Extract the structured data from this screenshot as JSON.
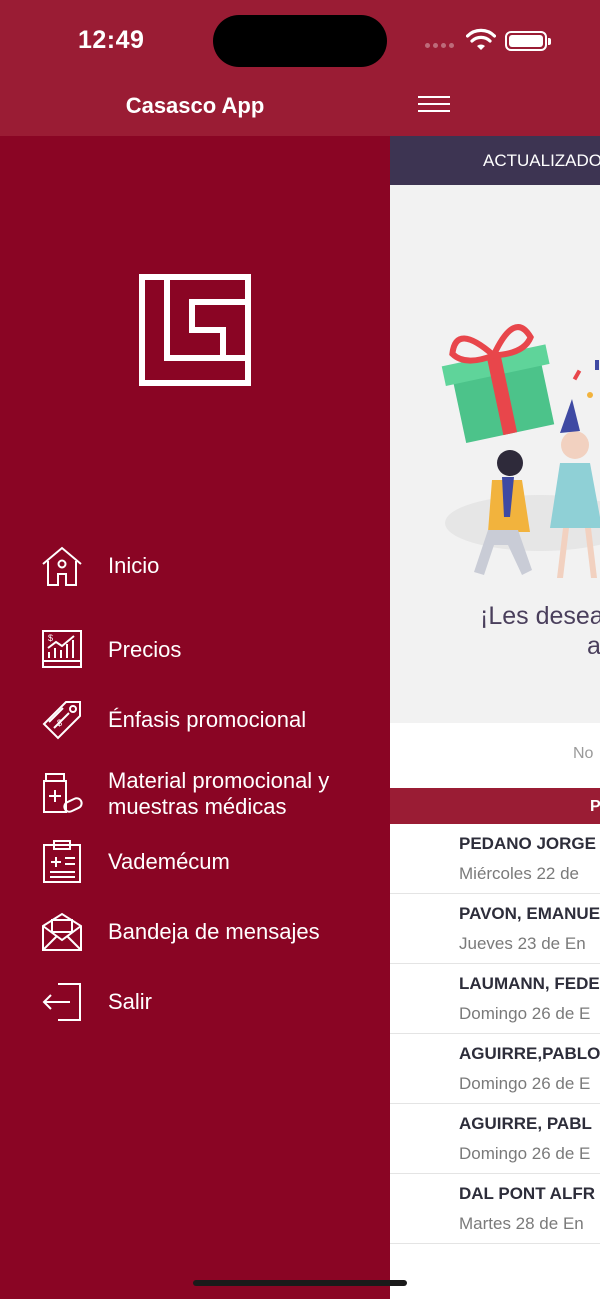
{
  "status": {
    "time": "12:49"
  },
  "app": {
    "title": "Casasco App"
  },
  "main": {
    "update_bar": "ACTUALIZADO",
    "hero_line1": "¡Les desea",
    "hero_line2": "a",
    "note": "No",
    "table_header": "P",
    "rows": [
      {
        "name": "PEDANO JORGE",
        "date": "Miércoles 22 de"
      },
      {
        "name": "PAVON, EMANUE",
        "date": "Jueves 23 de En"
      },
      {
        "name": "LAUMANN, FEDE",
        "date": "Domingo 26 de E"
      },
      {
        "name": "AGUIRRE,PABLO",
        "date": "Domingo 26 de E"
      },
      {
        "name": "AGUIRRE, PABL",
        "date": "Domingo 26 de E"
      },
      {
        "name": "DAL PONT ALFR",
        "date": "Martes 28 de En"
      }
    ]
  },
  "drawer": {
    "items": [
      {
        "label": "Inicio",
        "icon": "home-icon"
      },
      {
        "label": "Precios",
        "icon": "price-chart-icon"
      },
      {
        "label": "Énfasis promocional",
        "icon": "price-tag-icon"
      },
      {
        "label": "Material promocional y muestras médicas",
        "icon": "medicine-bottle-icon"
      },
      {
        "label": "Vademécum",
        "icon": "clipboard-icon"
      },
      {
        "label": "Bandeja de mensajes",
        "icon": "envelope-icon"
      },
      {
        "label": "Salir",
        "icon": "logout-icon"
      }
    ]
  },
  "colors": {
    "brand": "#9a1c34",
    "drawer": "#8a0524",
    "update_bar": "#3d3452"
  }
}
